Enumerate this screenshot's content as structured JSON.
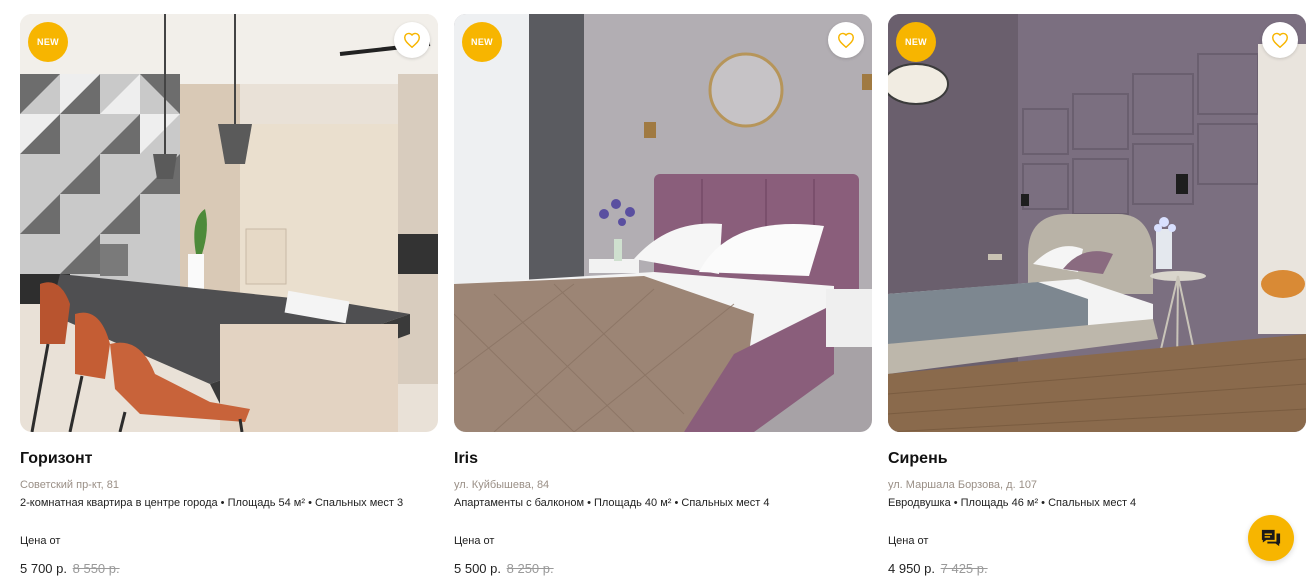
{
  "listings": [
    {
      "badge": "NEW",
      "title": "Горизонт",
      "address": "Советский пр-кт, 81",
      "description": "2-комнатная квартира в центре города • Площадь 54 м² • Спальных мест 3",
      "price_label": "Цена от",
      "price": "5 700 р.",
      "old_price": "8 550 р."
    },
    {
      "badge": "NEW",
      "title": "Iris",
      "address": "ул. Куйбышева, 84",
      "description": "Апартаменты с балконом • Площадь 40 м² • Спальных мест 4",
      "price_label": "Цена от",
      "price": "5 500 р.",
      "old_price": "8 250 р."
    },
    {
      "badge": "NEW",
      "title": "Сирень",
      "address": "ул. Маршала Борзова, д. 107",
      "description": "Евродвушка • Площадь 46 м² • Спальных мест 4",
      "price_label": "Цена от",
      "price": "4 950 р.",
      "old_price": "7 425 р."
    }
  ],
  "icons": {
    "favorite": "heart-icon",
    "chat": "chat-icon"
  },
  "colors": {
    "accent": "#f7b500",
    "address": "#9a8f86",
    "old_price": "#9a9a9a"
  }
}
